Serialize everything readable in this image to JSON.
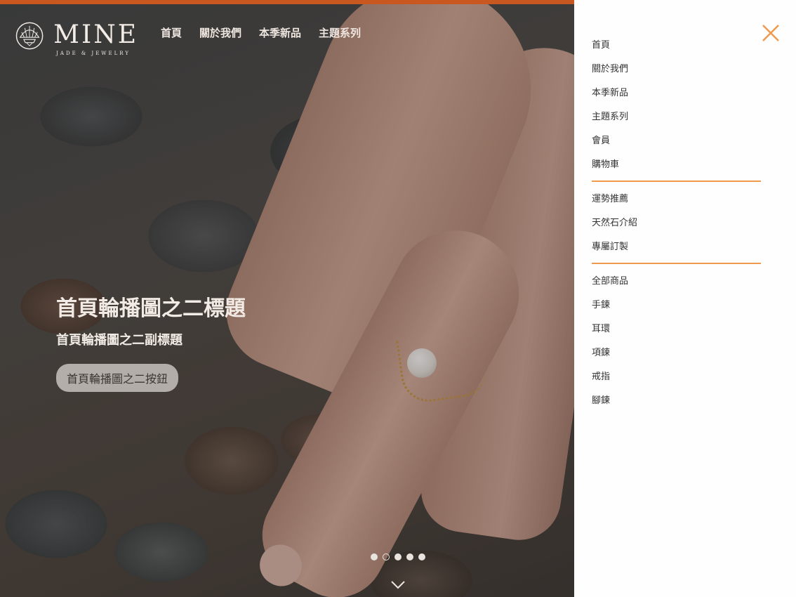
{
  "brand": {
    "name": "MINE",
    "tagline": "JADE & JEWELRY"
  },
  "topnav": [
    "首頁",
    "關於我們",
    "本季新品",
    "主題系列"
  ],
  "slide": {
    "title": "首頁輪播圖之二標題",
    "subtitle": "首頁輪播圖之二副標題",
    "button": "首頁輪播圖之二按鈕"
  },
  "carousel": {
    "slide_count": 5,
    "active_index": 1
  },
  "side_menu": {
    "group1": [
      "首頁",
      "關於我們",
      "本季新品",
      "主題系列",
      "會員",
      "購物車"
    ],
    "group2": [
      "運勢推薦",
      "天然石介紹",
      "專屬訂製"
    ],
    "group3": [
      "全部商品",
      "手鍊",
      "耳環",
      "項鍊",
      "戒指",
      "腳鍊"
    ]
  },
  "colors": {
    "accent": "#ef9a4e",
    "topbar": "#c8581f",
    "close": "#ef9a4e"
  },
  "icons": {
    "close": "close-icon",
    "down": "chevron-down-icon",
    "logo": "shell-logo-icon"
  }
}
